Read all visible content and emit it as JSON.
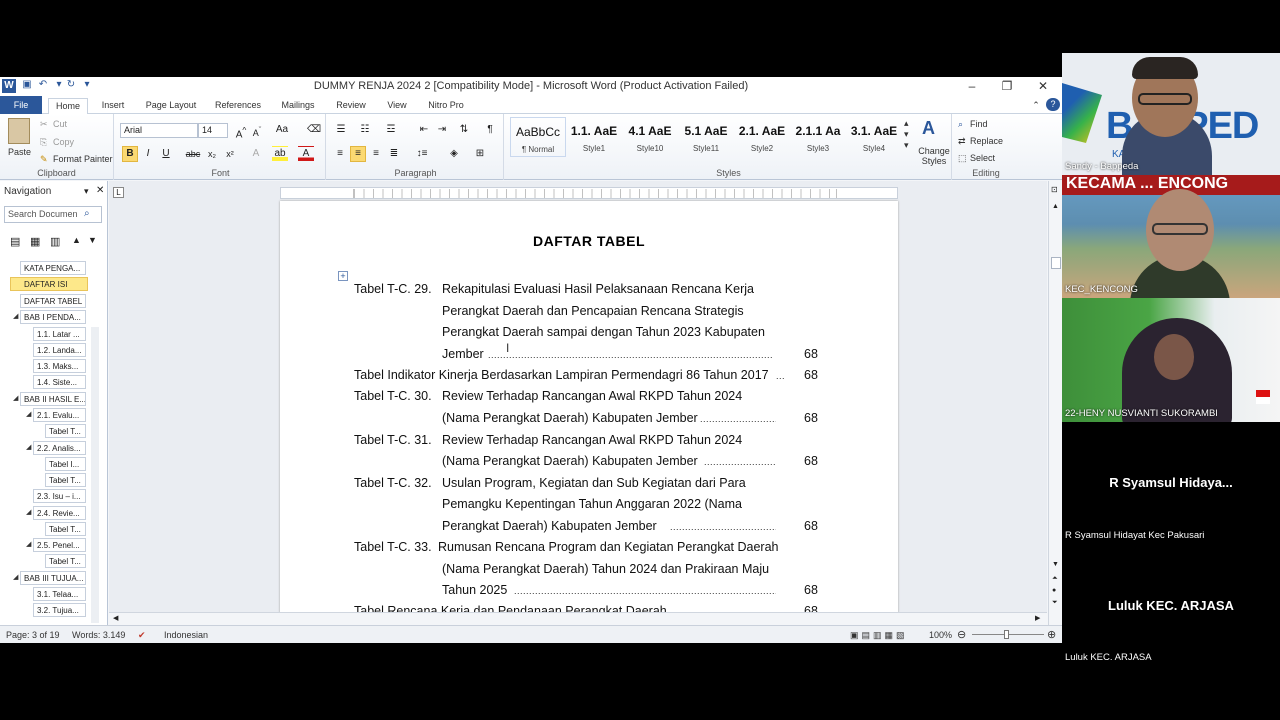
{
  "window": {
    "title": "DUMMY RENJA 2024 2 [Compatibility Mode]  -  Microsoft Word (Product Activation Failed)"
  },
  "tabs": [
    "File",
    "Home",
    "Insert",
    "Page Layout",
    "References",
    "Mailings",
    "Review",
    "View",
    "Nitro Pro"
  ],
  "active_tab": "Home",
  "ribbon": {
    "clipboard": {
      "paste": "Paste",
      "cut": "Cut",
      "copy": "Copy",
      "format_painter": "Format Painter",
      "label": "Clipboard"
    },
    "font": {
      "name": "Arial",
      "size": "14",
      "label": "Font"
    },
    "paragraph": {
      "label": "Paragraph"
    },
    "styles": {
      "label": "Styles",
      "items": [
        {
          "sample": "AaBbCc",
          "name": "¶ Normal"
        },
        {
          "sample": "1.1. AaE",
          "name": "Style1"
        },
        {
          "sample": "4.1 AaE",
          "name": "Style10"
        },
        {
          "sample": "5.1 AaE",
          "name": "Style11"
        },
        {
          "sample": "2.1. AaE",
          "name": "Style2"
        },
        {
          "sample": "2.1.1 Aa",
          "name": "Style3"
        },
        {
          "sample": "3.1. AaE",
          "name": "Style4"
        }
      ],
      "change_styles": "Change Styles"
    },
    "editing": {
      "find": "Find",
      "replace": "Replace",
      "select": "Select",
      "label": "Editing"
    }
  },
  "navigation": {
    "title": "Navigation",
    "search_placeholder": "Search Documen",
    "items": [
      "KATA PENGA...",
      "DAFTAR ISI",
      "DAFTAR TABEL",
      "BAB I PENDA...",
      "1.1. Latar ...",
      "1.2. Landa...",
      "1.3. Maks...",
      "1.4. Siste...",
      "BAB II HASIL E...",
      "2.1. Evalu...",
      "Tabel T...",
      "2.2. Analis...",
      "Tabel I...",
      "Tabel T...",
      "2.3. Isu – i...",
      "2.4. Revie...",
      "Tabel T...",
      "2.5. Penel...",
      "Tabel T...",
      "BAB III TUJUA...",
      "3.1. Telaa...",
      "3.2. Tujua..."
    ],
    "highlighted": "DAFTAR ISI"
  },
  "document": {
    "heading": "DAFTAR TABEL",
    "entries": {
      "t29": {
        "prefix": "Tabel T-C. 29.",
        "l1": "Rekapitulasi Evaluasi Hasil Pelaksanaan Rencana Kerja",
        "l2": "Perangkat Daerah dan Pencapaian Rencana Strategis",
        "l3": "Perangkat Daerah sampai dengan Tahun 2023 Kabupaten",
        "l4": "Jember",
        "page": "68"
      },
      "ind": {
        "text": "Tabel Indikator Kinerja Berdasarkan Lampiran Permendagri 86 Tahun 2017",
        "page": "68"
      },
      "t30": {
        "prefix": "Tabel T-C. 30.",
        "l1": "Review Terhadap Rancangan Awal RKPD Tahun 2024",
        "l2": "(Nama Perangkat Daerah) Kabupaten Jember",
        "page": "68"
      },
      "t31": {
        "prefix": "Tabel T-C. 31.",
        "l1": "Review Terhadap Rancangan Awal RKPD Tahun 2024",
        "l2": "(Nama Perangkat Daerah)  Kabupaten Jember",
        "page": "68"
      },
      "t32": {
        "prefix": "Tabel T-C. 32.",
        "l1": "Usulan Program, Kegiatan dan Sub Kegiatan dari Para",
        "l2": "Pemangku Kepentingan Tahun Anggaran 2022 (Nama",
        "l3": "Perangkat Daerah)   Kabupaten Jember",
        "page": "68"
      },
      "t33": {
        "prefix": "Tabel T-C. 33.",
        "l1": "Rumusan Rencana Program dan Kegiatan Perangkat Daerah",
        "l2": "(Nama Perangkat Daerah)  Tahun 2024 dan Prakiraan Maju",
        "l3": "Tahun 2025",
        "page": "68"
      },
      "last": {
        "text": "Tabel Rencana Kerja dan Pendanaan Perangkat Daerah",
        "page": "68"
      }
    }
  },
  "status": {
    "page": "Page: 3 of 19",
    "words": "Words: 3.149",
    "language": "Indonesian",
    "zoom": "100%"
  },
  "participants": [
    {
      "caption": "Sandy - Bappeda",
      "banner": "BAPPED",
      "sub": "KA ... BER"
    },
    {
      "caption": "KEC_KENCONG",
      "banner": "KECAMA ... ENCONG"
    },
    {
      "caption": "22-HENY NUSVIANTI SUKORAMBI"
    },
    {
      "name": "R Syamsul Hidaya...",
      "caption": "R Syamsul Hidayat Kec Pakusari"
    },
    {
      "name": "Luluk KEC. ARJASA",
      "caption": "Luluk KEC. ARJASA"
    }
  ],
  "colors": {
    "word_blue": "#2b579a",
    "nav_highlight": "#fde88a",
    "bappeda_blue": "#1f5fb0"
  }
}
